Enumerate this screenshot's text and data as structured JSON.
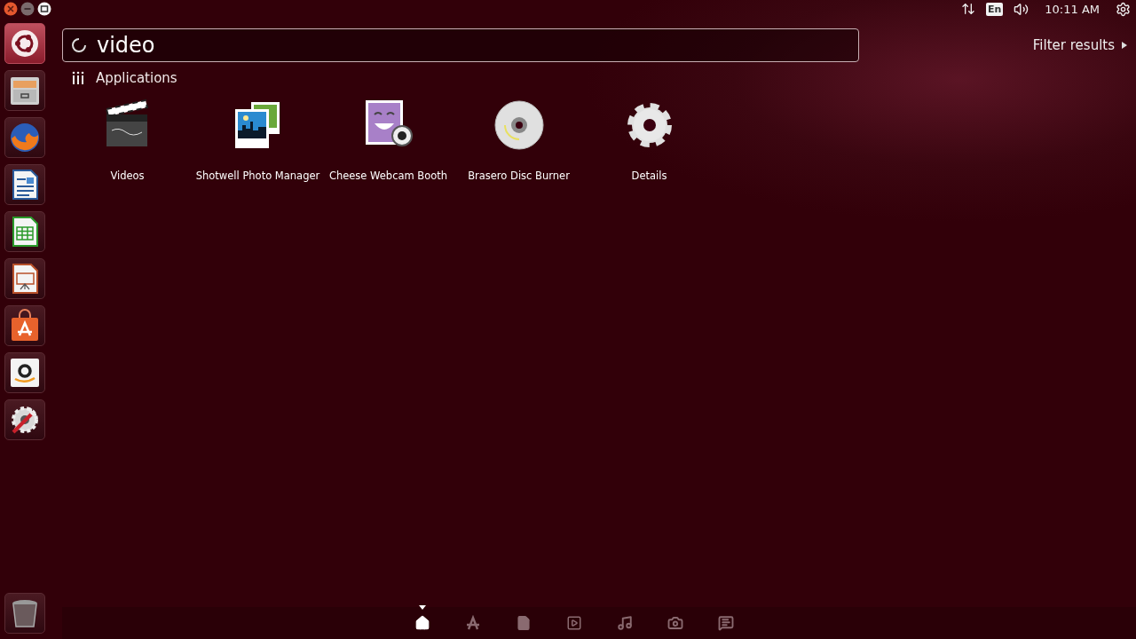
{
  "window_controls": [
    {
      "kind": "close"
    },
    {
      "kind": "minimize"
    },
    {
      "kind": "maximize"
    }
  ],
  "panel": {
    "indicators": [
      {
        "kind": "network"
      },
      {
        "kind": "keyboard",
        "label": "En"
      },
      {
        "kind": "sound"
      },
      {
        "kind": "clock",
        "label": "10:11 AM"
      },
      {
        "kind": "system"
      }
    ]
  },
  "launcher": {
    "items": [
      {
        "kind": "dash",
        "selected": true
      },
      {
        "kind": "files",
        "selected": false
      },
      {
        "kind": "browser",
        "selected": false
      },
      {
        "kind": "writer",
        "selected": false
      },
      {
        "kind": "calc",
        "selected": false
      },
      {
        "kind": "impress",
        "selected": false
      },
      {
        "kind": "software",
        "selected": false
      },
      {
        "kind": "shop",
        "selected": false
      },
      {
        "kind": "settings",
        "selected": false
      }
    ],
    "bottom_items": [
      {
        "kind": "trash",
        "selected": false
      }
    ]
  },
  "search": {
    "value": "video"
  },
  "filter": {
    "label": "Filter results"
  },
  "category": {
    "title": "Applications"
  },
  "apps": [
    {
      "kind": "clapper",
      "name": "Videos"
    },
    {
      "kind": "photos",
      "name": "Shotwell Photo Manager"
    },
    {
      "kind": "webcam",
      "name": "Cheese Webcam Booth"
    },
    {
      "kind": "disc",
      "name": "Brasero Disc Burner"
    },
    {
      "kind": "gear",
      "name": "Details"
    }
  ],
  "lenses": [
    {
      "kind": "home",
      "selected": true
    },
    {
      "kind": "apps",
      "selected": false
    },
    {
      "kind": "files",
      "selected": false
    },
    {
      "kind": "video",
      "selected": false
    },
    {
      "kind": "music",
      "selected": false
    },
    {
      "kind": "photos",
      "selected": false
    },
    {
      "kind": "social",
      "selected": false
    }
  ]
}
